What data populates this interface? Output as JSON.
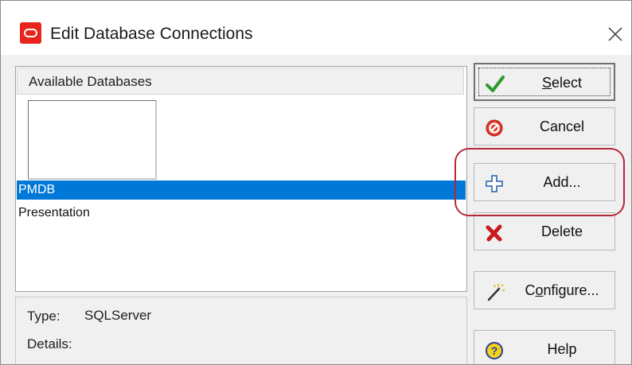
{
  "window": {
    "title": "Edit Database Connections"
  },
  "list": {
    "header": "Available Databases",
    "items": [
      {
        "label": "PMDB",
        "selected": true
      },
      {
        "label": "Presentation",
        "selected": false
      }
    ]
  },
  "info": {
    "type_label": "Type:",
    "type_value": "SQLServer",
    "details_label": "Details:"
  },
  "buttons": {
    "select": {
      "pre": "",
      "u": "S",
      "post": "elect",
      "icon": "checkmark-icon"
    },
    "cancel": {
      "label": "Cancel",
      "icon": "cancel-icon"
    },
    "add": {
      "label": "Add...",
      "icon": "plus-icon"
    },
    "delete": {
      "label": "Delete",
      "icon": "x-icon"
    },
    "configure": {
      "pre": "C",
      "u": "o",
      "post": "nfigure...",
      "icon": "magic-wand-icon"
    },
    "help": {
      "label": "Help",
      "icon": "help-icon"
    }
  },
  "colors": {
    "selection": "#0078d7",
    "highlight_ring": "#b5283a",
    "app_icon": "#e8241c"
  }
}
